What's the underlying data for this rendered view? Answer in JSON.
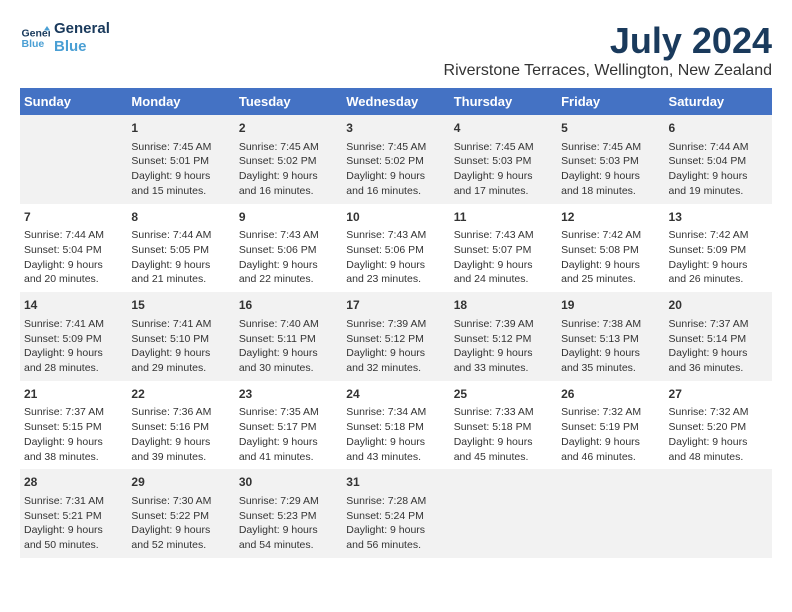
{
  "logo": {
    "line1": "General",
    "line2": "Blue"
  },
  "title": "July 2024",
  "subtitle": "Riverstone Terraces, Wellington, New Zealand",
  "days_header": [
    "Sunday",
    "Monday",
    "Tuesday",
    "Wednesday",
    "Thursday",
    "Friday",
    "Saturday"
  ],
  "weeks": [
    [
      {
        "day": "",
        "content": ""
      },
      {
        "day": "1",
        "content": "Sunrise: 7:45 AM\nSunset: 5:01 PM\nDaylight: 9 hours\nand 15 minutes."
      },
      {
        "day": "2",
        "content": "Sunrise: 7:45 AM\nSunset: 5:02 PM\nDaylight: 9 hours\nand 16 minutes."
      },
      {
        "day": "3",
        "content": "Sunrise: 7:45 AM\nSunset: 5:02 PM\nDaylight: 9 hours\nand 16 minutes."
      },
      {
        "day": "4",
        "content": "Sunrise: 7:45 AM\nSunset: 5:03 PM\nDaylight: 9 hours\nand 17 minutes."
      },
      {
        "day": "5",
        "content": "Sunrise: 7:45 AM\nSunset: 5:03 PM\nDaylight: 9 hours\nand 18 minutes."
      },
      {
        "day": "6",
        "content": "Sunrise: 7:44 AM\nSunset: 5:04 PM\nDaylight: 9 hours\nand 19 minutes."
      }
    ],
    [
      {
        "day": "7",
        "content": "Sunrise: 7:44 AM\nSunset: 5:04 PM\nDaylight: 9 hours\nand 20 minutes."
      },
      {
        "day": "8",
        "content": "Sunrise: 7:44 AM\nSunset: 5:05 PM\nDaylight: 9 hours\nand 21 minutes."
      },
      {
        "day": "9",
        "content": "Sunrise: 7:43 AM\nSunset: 5:06 PM\nDaylight: 9 hours\nand 22 minutes."
      },
      {
        "day": "10",
        "content": "Sunrise: 7:43 AM\nSunset: 5:06 PM\nDaylight: 9 hours\nand 23 minutes."
      },
      {
        "day": "11",
        "content": "Sunrise: 7:43 AM\nSunset: 5:07 PM\nDaylight: 9 hours\nand 24 minutes."
      },
      {
        "day": "12",
        "content": "Sunrise: 7:42 AM\nSunset: 5:08 PM\nDaylight: 9 hours\nand 25 minutes."
      },
      {
        "day": "13",
        "content": "Sunrise: 7:42 AM\nSunset: 5:09 PM\nDaylight: 9 hours\nand 26 minutes."
      }
    ],
    [
      {
        "day": "14",
        "content": "Sunrise: 7:41 AM\nSunset: 5:09 PM\nDaylight: 9 hours\nand 28 minutes."
      },
      {
        "day": "15",
        "content": "Sunrise: 7:41 AM\nSunset: 5:10 PM\nDaylight: 9 hours\nand 29 minutes."
      },
      {
        "day": "16",
        "content": "Sunrise: 7:40 AM\nSunset: 5:11 PM\nDaylight: 9 hours\nand 30 minutes."
      },
      {
        "day": "17",
        "content": "Sunrise: 7:39 AM\nSunset: 5:12 PM\nDaylight: 9 hours\nand 32 minutes."
      },
      {
        "day": "18",
        "content": "Sunrise: 7:39 AM\nSunset: 5:12 PM\nDaylight: 9 hours\nand 33 minutes."
      },
      {
        "day": "19",
        "content": "Sunrise: 7:38 AM\nSunset: 5:13 PM\nDaylight: 9 hours\nand 35 minutes."
      },
      {
        "day": "20",
        "content": "Sunrise: 7:37 AM\nSunset: 5:14 PM\nDaylight: 9 hours\nand 36 minutes."
      }
    ],
    [
      {
        "day": "21",
        "content": "Sunrise: 7:37 AM\nSunset: 5:15 PM\nDaylight: 9 hours\nand 38 minutes."
      },
      {
        "day": "22",
        "content": "Sunrise: 7:36 AM\nSunset: 5:16 PM\nDaylight: 9 hours\nand 39 minutes."
      },
      {
        "day": "23",
        "content": "Sunrise: 7:35 AM\nSunset: 5:17 PM\nDaylight: 9 hours\nand 41 minutes."
      },
      {
        "day": "24",
        "content": "Sunrise: 7:34 AM\nSunset: 5:18 PM\nDaylight: 9 hours\nand 43 minutes."
      },
      {
        "day": "25",
        "content": "Sunrise: 7:33 AM\nSunset: 5:18 PM\nDaylight: 9 hours\nand 45 minutes."
      },
      {
        "day": "26",
        "content": "Sunrise: 7:32 AM\nSunset: 5:19 PM\nDaylight: 9 hours\nand 46 minutes."
      },
      {
        "day": "27",
        "content": "Sunrise: 7:32 AM\nSunset: 5:20 PM\nDaylight: 9 hours\nand 48 minutes."
      }
    ],
    [
      {
        "day": "28",
        "content": "Sunrise: 7:31 AM\nSunset: 5:21 PM\nDaylight: 9 hours\nand 50 minutes."
      },
      {
        "day": "29",
        "content": "Sunrise: 7:30 AM\nSunset: 5:22 PM\nDaylight: 9 hours\nand 52 minutes."
      },
      {
        "day": "30",
        "content": "Sunrise: 7:29 AM\nSunset: 5:23 PM\nDaylight: 9 hours\nand 54 minutes."
      },
      {
        "day": "31",
        "content": "Sunrise: 7:28 AM\nSunset: 5:24 PM\nDaylight: 9 hours\nand 56 minutes."
      },
      {
        "day": "",
        "content": ""
      },
      {
        "day": "",
        "content": ""
      },
      {
        "day": "",
        "content": ""
      }
    ]
  ]
}
